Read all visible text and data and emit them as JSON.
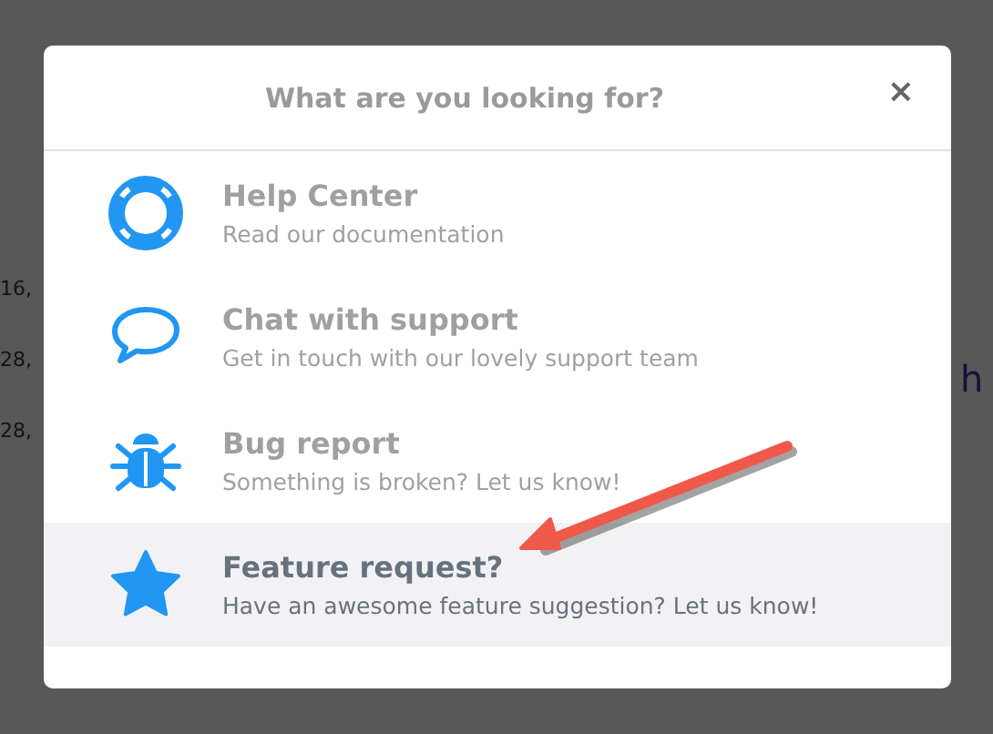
{
  "background": {
    "texts": [
      {
        "text": "16,"
      },
      {
        "text": "28,"
      },
      {
        "text": "28,"
      }
    ],
    "link_fragment": "h"
  },
  "modal": {
    "title": "What are you looking for?",
    "close": "×",
    "items": [
      {
        "kind": "lifebuoy",
        "title": "Help Center",
        "subtitle": "Read our documentation",
        "selected": false
      },
      {
        "kind": "chat",
        "title": "Chat with support",
        "subtitle": "Get in touch with our lovely support team",
        "selected": false
      },
      {
        "kind": "bug",
        "title": "Bug report",
        "subtitle": "Something is broken? Let us know!",
        "selected": false
      },
      {
        "kind": "star",
        "title": "Feature request?",
        "subtitle": "Have an awesome feature suggestion? Let us know!",
        "selected": true
      }
    ]
  },
  "annotation": {
    "kind": "arrow",
    "color": "#f0584a"
  }
}
